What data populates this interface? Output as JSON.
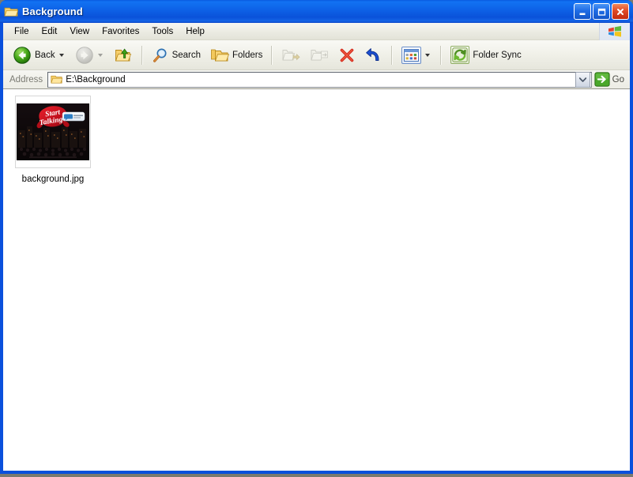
{
  "window": {
    "title": "Background",
    "title_icon": "folder-icon",
    "buttons": {
      "minimize": "minimize-button",
      "maximize": "maximize-button",
      "close": "close-button"
    }
  },
  "menubar": {
    "items": [
      {
        "label": "File"
      },
      {
        "label": "Edit"
      },
      {
        "label": "View"
      },
      {
        "label": "Favorites"
      },
      {
        "label": "Tools"
      },
      {
        "label": "Help"
      }
    ],
    "flag_icon": "windows-flag-icon"
  },
  "toolbar": {
    "back": {
      "label": "Back",
      "icon": "back-arrow-icon",
      "enabled": true
    },
    "forward": {
      "label": "",
      "icon": "forward-arrow-icon",
      "enabled": false
    },
    "up": {
      "label": "",
      "icon": "up-one-level-icon",
      "enabled": true
    },
    "search": {
      "label": "Search",
      "icon": "search-icon"
    },
    "folders": {
      "label": "Folders",
      "icon": "folders-icon"
    },
    "move_to": {
      "label": "",
      "icon": "move-to-icon",
      "enabled": false
    },
    "copy_to": {
      "label": "",
      "icon": "copy-to-icon",
      "enabled": false
    },
    "delete": {
      "label": "",
      "icon": "delete-icon",
      "enabled": true
    },
    "undo": {
      "label": "",
      "icon": "undo-icon",
      "enabled": true
    },
    "views": {
      "label": "",
      "icon": "views-icon"
    },
    "folder_sync": {
      "label": "Folder Sync",
      "icon": "folder-sync-icon"
    }
  },
  "address": {
    "label": "Address",
    "icon": "folder-icon",
    "value": "E:\\Background",
    "placeholder": "",
    "go_label": "Go",
    "go_icon": "go-arrow-icon",
    "dropdown_icon": "chevron-down-icon"
  },
  "content": {
    "files": [
      {
        "name": "background.jpg",
        "thumbnail": {
          "alt": "start-talking-night-scene",
          "headline_line1": "Start",
          "headline_line2": "Talking",
          "badge_text": "logo"
        }
      }
    ]
  },
  "colors": {
    "title_blue": "#0e63e8",
    "frame_blue": "#0a50dc",
    "toolbar_face": "#f0f0e8",
    "accent_green": "#3a9e18",
    "delete_red": "#d42a1c",
    "undo_blue": "#1c4fd0",
    "content_bg": "#ffffff",
    "splash_red": "#cf1020"
  }
}
